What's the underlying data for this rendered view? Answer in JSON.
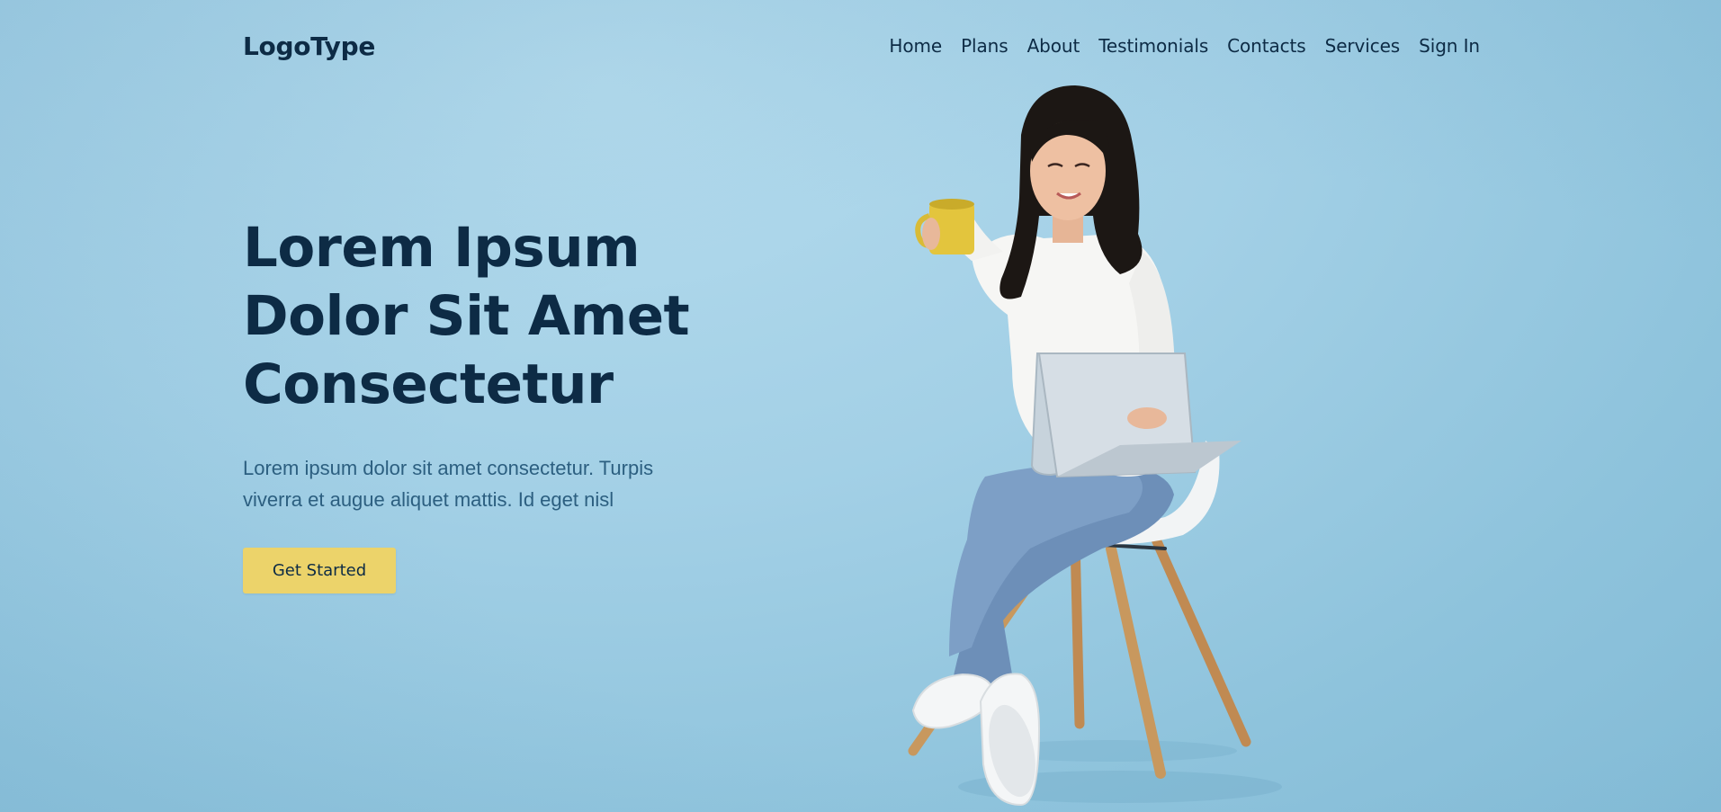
{
  "header": {
    "logo": "LogoType",
    "nav": [
      {
        "label": "Home"
      },
      {
        "label": "Plans"
      },
      {
        "label": "About"
      },
      {
        "label": "Testimonials"
      },
      {
        "label": "Contacts"
      },
      {
        "label": "Services"
      },
      {
        "label": "Sign In"
      }
    ]
  },
  "hero": {
    "title_lines": [
      "Lorem Ipsum",
      "Dolor Sit Amet",
      "Consectetur"
    ],
    "subtitle_lines": [
      "Lorem ipsum dolor sit amet consectetur. Turpis",
      "viverra et augue aliquet mattis. Id eget nisl"
    ],
    "cta_label": "Get Started",
    "image": "woman-with-laptop-on-chair"
  },
  "colors": {
    "background": "#a3d0e6",
    "text": "#0d2b45",
    "subtitle": "#2c5f80",
    "accent": "#ecd36a"
  }
}
